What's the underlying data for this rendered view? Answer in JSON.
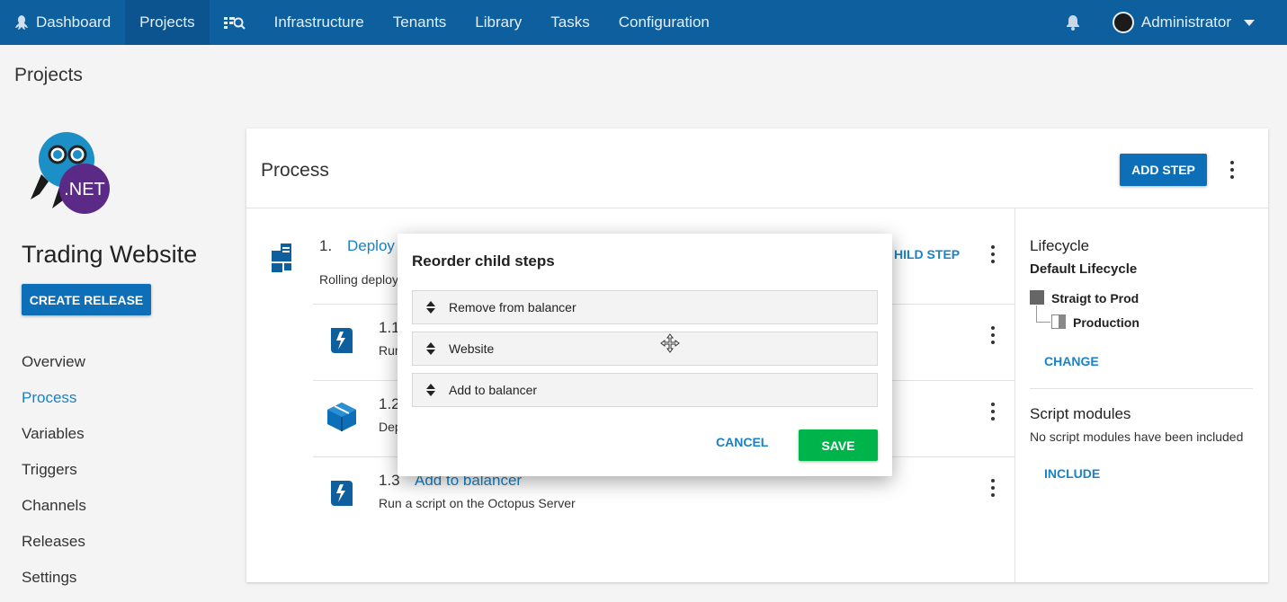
{
  "topnav": {
    "items": [
      {
        "label": "Dashboard",
        "icon": "octopus-icon"
      },
      {
        "label": "Projects",
        "active": true
      },
      {
        "label": "",
        "icon": "search-list-icon"
      },
      {
        "label": "Infrastructure"
      },
      {
        "label": "Tenants"
      },
      {
        "label": "Library"
      },
      {
        "label": "Tasks"
      },
      {
        "label": "Configuration"
      }
    ],
    "user": "Administrator",
    "color": "#0d5f9e"
  },
  "page_title": "Projects",
  "sidebar": {
    "project_name": "Trading Website",
    "create_release": "CREATE RELEASE",
    "logo_text": ".NET",
    "items": [
      {
        "label": "Overview"
      },
      {
        "label": "Process",
        "active": true
      },
      {
        "label": "Variables"
      },
      {
        "label": "Triggers"
      },
      {
        "label": "Channels"
      },
      {
        "label": "Releases"
      },
      {
        "label": "Settings"
      }
    ]
  },
  "process": {
    "title": "Process",
    "add_step": "ADD STEP",
    "parent_step": {
      "num": "1.",
      "name": "Deploy",
      "desc": "Rolling deploy",
      "add_child": "HILD STEP"
    },
    "child_steps": [
      {
        "num": "1.1",
        "desc": "Run"
      },
      {
        "num": "1.2",
        "desc": "Dep"
      },
      {
        "num": "1.3",
        "name": "Add to balancer",
        "desc": "Run a script on the Octopus Server"
      }
    ]
  },
  "lifecycle": {
    "heading": "Lifecycle",
    "name": "Default Lifecycle",
    "phases": [
      "Straigt to Prod",
      "Production"
    ],
    "change": "CHANGE"
  },
  "script_modules": {
    "heading": "Script modules",
    "text": "No script modules have been included",
    "include": "INCLUDE"
  },
  "modal": {
    "title": "Reorder child steps",
    "items": [
      "Remove from balancer",
      "Website",
      "Add to balancer"
    ],
    "cancel": "CANCEL",
    "save": "SAVE"
  },
  "colors": {
    "accent": "#0d6fb8",
    "link": "#1a82c4",
    "save": "#00b44c"
  }
}
